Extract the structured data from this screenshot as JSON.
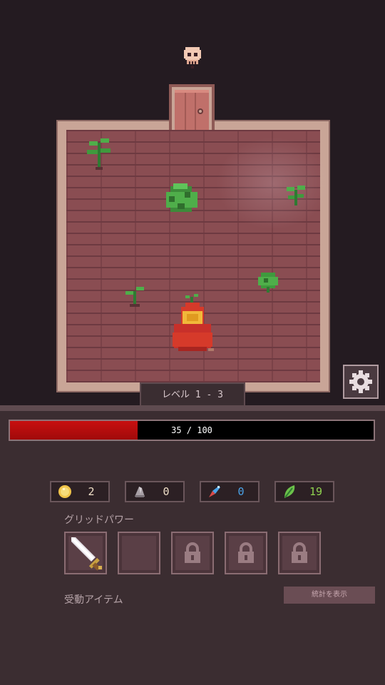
{
  "level": {
    "label": "レベル 1 - 3"
  },
  "hp": {
    "current": 35,
    "max": 100,
    "text": "35 / 100",
    "fill_fraction": 0.35,
    "color": "#c81010"
  },
  "resources": [
    {
      "icon": "coin-icon",
      "value": "2",
      "color": "#f0e0c8"
    },
    {
      "icon": "stone-icon",
      "value": "0",
      "color": "#f0e0c8"
    },
    {
      "icon": "crystal-icon",
      "value": "0",
      "color": "#4aa3e8"
    },
    {
      "icon": "leaf-icon",
      "value": "19",
      "color": "#8fd14f"
    }
  ],
  "grid_power": {
    "label": "グリッドパワー",
    "slots": [
      {
        "state": "sword",
        "icon": "sword-icon"
      },
      {
        "state": "empty"
      },
      {
        "state": "locked",
        "icon": "lock-icon"
      },
      {
        "state": "locked",
        "icon": "lock-icon"
      },
      {
        "state": "locked",
        "icon": "lock-icon"
      }
    ]
  },
  "passive_items": {
    "label": "受動アイテム"
  },
  "stats_button": {
    "label": "統計を表示"
  },
  "settings": {
    "icon": "gear-icon"
  },
  "colors": {
    "panel_bg": "#3b2d31",
    "floor": "#8a4d52",
    "frame": "#c9a597"
  }
}
